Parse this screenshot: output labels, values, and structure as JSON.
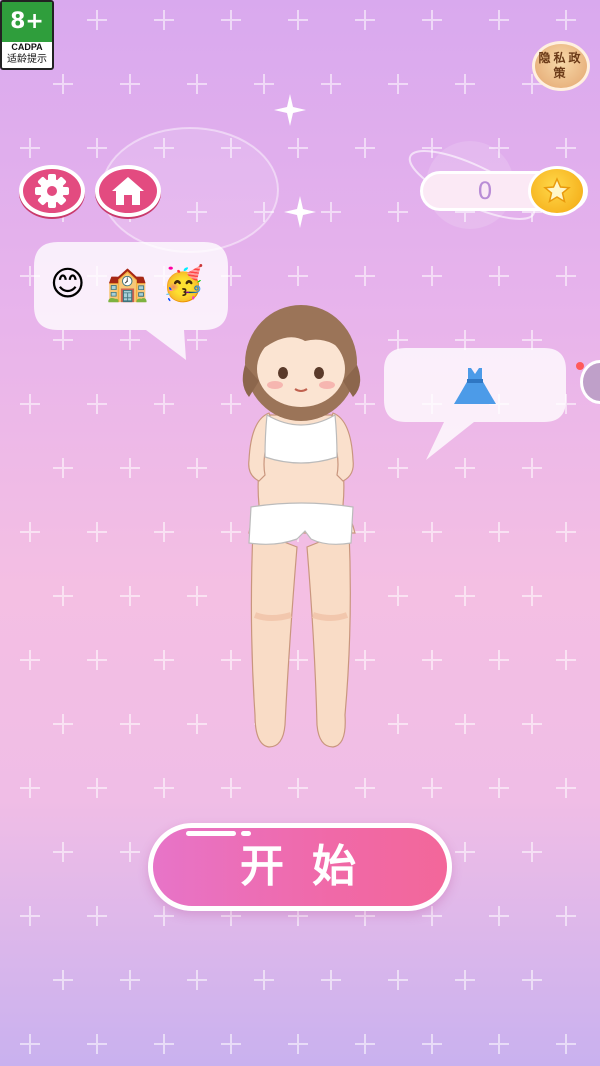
{
  "age_badge": {
    "rating": "8+",
    "org": "CADPA",
    "caption": "适龄提示"
  },
  "privacy": {
    "label": "隐私政策"
  },
  "settings_button": {
    "icon": "gear-icon"
  },
  "home_button": {
    "icon": "home-icon"
  },
  "coins": {
    "value": "0",
    "icon": "star-coin-icon"
  },
  "thought_bubble_left": {
    "emojis": [
      "😊",
      "🏫",
      "🥳"
    ]
  },
  "thought_bubble_right": {
    "item": "dress-icon"
  },
  "start_button": {
    "label": "开始"
  },
  "colors": {
    "accent": "#e34b80",
    "start_pink": "#f069a8",
    "coin": "#f5b91e",
    "bg_top": "#d9a9ee",
    "bg_mid": "#f4bfe3"
  }
}
